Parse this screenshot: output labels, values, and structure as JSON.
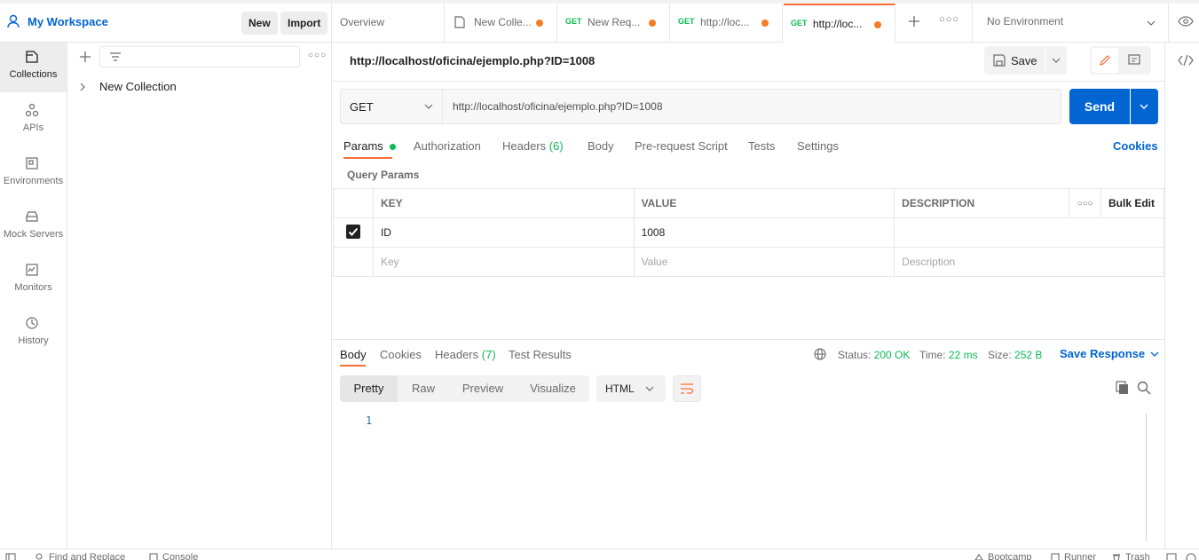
{
  "workspace": {
    "title": "My Workspace",
    "new_label": "New",
    "import_label": "Import"
  },
  "tabs": [
    {
      "label": "Overview"
    },
    {
      "label": "New Colle...",
      "unsaved": true
    },
    {
      "method": "GET",
      "label": "New Req...",
      "unsaved": true
    },
    {
      "method": "GET",
      "label": "http://loc...",
      "unsaved": true
    },
    {
      "method": "GET",
      "label": "http://loc...",
      "unsaved": true,
      "active": true
    }
  ],
  "environment": {
    "selected": "No Environment"
  },
  "rail": [
    {
      "label": "Collections",
      "icon": "collections-icon",
      "selected": true
    },
    {
      "label": "APIs",
      "icon": "apis-icon"
    },
    {
      "label": "Environments",
      "icon": "environments-icon"
    },
    {
      "label": "Mock Servers",
      "icon": "mock-servers-icon"
    },
    {
      "label": "Monitors",
      "icon": "monitors-icon"
    },
    {
      "label": "History",
      "icon": "history-icon"
    }
  ],
  "sidebar": {
    "collection_name": "New Collection"
  },
  "request": {
    "title": "http://localhost/oficina/ejemplo.php?ID=1008",
    "save_label": "Save",
    "method": "GET",
    "url": "http://localhost/oficina/ejemplo.php?ID=1008",
    "send_label": "Send"
  },
  "request_tabs": {
    "params": "Params",
    "authorization": "Authorization",
    "headers": "Headers",
    "headers_count": "(6)",
    "body": "Body",
    "prerequest": "Pre-request Script",
    "tests": "Tests",
    "settings": "Settings",
    "cookies": "Cookies"
  },
  "query_params": {
    "title": "Query Params",
    "columns": {
      "key": "KEY",
      "value": "VALUE",
      "description": "DESCRIPTION"
    },
    "bulk_edit": "Bulk Edit",
    "rows": [
      {
        "key": "ID",
        "value": "1008",
        "description": "",
        "checked": true
      }
    ],
    "placeholders": {
      "key": "Key",
      "value": "Value",
      "description": "Description"
    }
  },
  "response": {
    "tabs": {
      "body": "Body",
      "cookies": "Cookies",
      "headers": "Headers",
      "headers_count": "(7)",
      "test_results": "Test Results"
    },
    "status_label": "Status:",
    "status": "200 OK",
    "time_label": "Time:",
    "time": "22 ms",
    "size_label": "Size:",
    "size": "252 B",
    "save_response": "Save Response",
    "views": {
      "pretty": "Pretty",
      "raw": "Raw",
      "preview": "Preview",
      "visualize": "Visualize"
    },
    "format": "HTML",
    "line_number": "1"
  },
  "footer": {
    "find_replace": "Find and Replace",
    "console": "Console",
    "bootcamp": "Bootcamp",
    "runner": "Runner",
    "trash": "Trash"
  },
  "colors": {
    "accent": "#0265d2",
    "orange": "#ff6c37",
    "green": "#0cbb52"
  }
}
